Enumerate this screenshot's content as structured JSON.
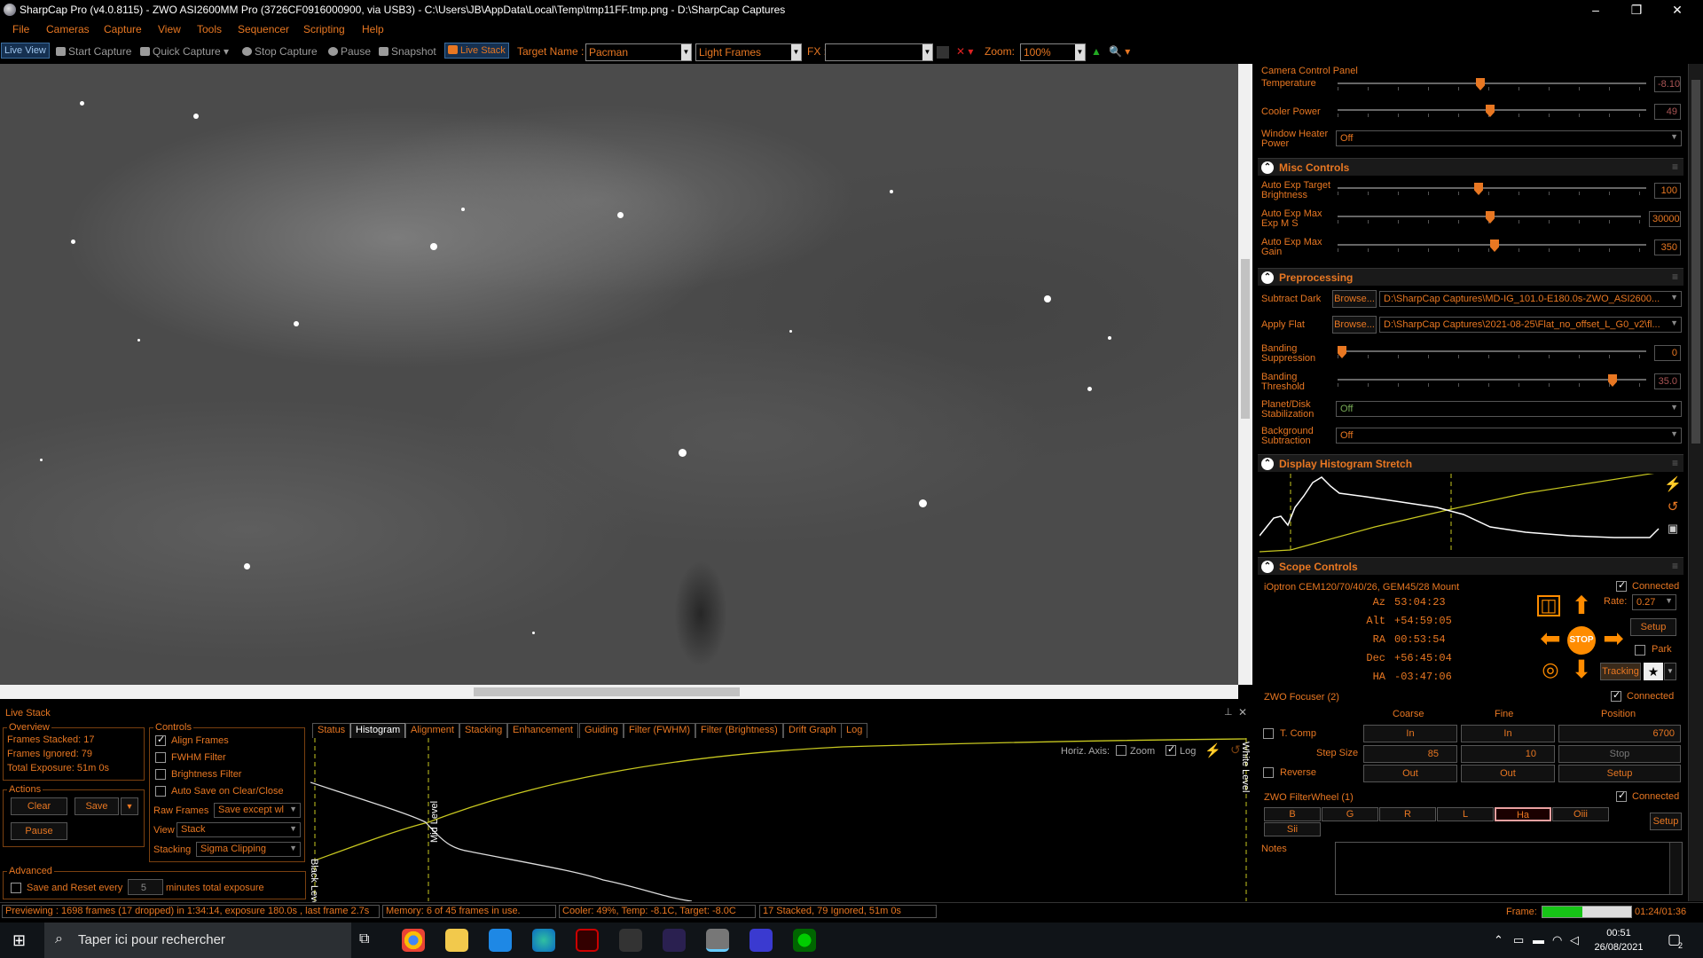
{
  "app": {
    "title": "SharpCap Pro (v4.0.8115) - ZWO ASI2600MM Pro (3726CF0916000900, via USB3) - C:\\Users\\JB\\AppData\\Local\\Temp\\tmp11FF.tmp.png - D:\\SharpCap Captures",
    "window_controls": [
      "–",
      "❐",
      "✕"
    ]
  },
  "menu": [
    "File",
    "Cameras",
    "Capture",
    "View",
    "Tools",
    "Sequencer",
    "Scripting",
    "Help"
  ],
  "toolbar": {
    "live_view": "Live View",
    "start_capture": "Start Capture",
    "quick_capture": "Quick Capture",
    "stop_capture": "Stop Capture",
    "pause": "Pause",
    "snapshot": "Snapshot",
    "live_stack": "Live Stack",
    "target_name_label": "Target Name :",
    "target_name": "Pacman",
    "frame_type": "Light Frames",
    "fx_label": "FX :",
    "fx_value": "",
    "zoom_label": "Zoom:",
    "zoom_value": "100%"
  },
  "camera_panel": {
    "title": "Camera Control Panel",
    "temperature_label": "Temperature",
    "temperature_value": "-8.10",
    "cooler_power_label": "Cooler Power",
    "cooler_power_value": "49",
    "window_heater_label": "Window Heater Power",
    "window_heater_value": "Off"
  },
  "misc": {
    "title": "Misc Controls",
    "auto_exp_target_label": "Auto Exp Target Brightness",
    "auto_exp_target_value": "100",
    "auto_exp_max_label": "Auto Exp Max Exp M S",
    "auto_exp_max_value": "30000",
    "auto_exp_gain_label": "Auto Exp Max Gain",
    "auto_exp_gain_value": "350"
  },
  "preprocessing": {
    "title": "Preprocessing",
    "subtract_dark_label": "Subtract Dark",
    "subtract_dark_path": "D:\\SharpCap Captures\\MD-IG_101.0-E180.0s-ZWO_ASI2600...",
    "apply_flat_label": "Apply Flat",
    "apply_flat_path": "D:\\SharpCap Captures\\2021-08-25\\Flat_no_offset_L_G0_v2\\fl...",
    "browse": "Browse...",
    "banding_supp_label": "Banding Suppression",
    "banding_supp_value": "0",
    "banding_thresh_label": "Banding Threshold",
    "banding_thresh_value": "35.0",
    "planet_label": "Planet/Disk Stabilization",
    "planet_value": "Off",
    "bg_sub_label": "Background Subtraction",
    "bg_sub_value": "Off"
  },
  "histogram_stretch": {
    "title": "Display Histogram Stretch"
  },
  "scope": {
    "title": "Scope Controls",
    "mount": "iOptron CEM120/70/40/26, GEM45/28 Mount",
    "connected": "Connected",
    "coords": [
      {
        "label": "Az",
        "value": "53:04:23"
      },
      {
        "label": "Alt",
        "value": "+54:59:05"
      },
      {
        "label": "RA",
        "value": "00:53:54"
      },
      {
        "label": "Dec",
        "value": "+56:45:04"
      },
      {
        "label": "HA",
        "value": "-03:47:06"
      }
    ],
    "rate_label": "Rate:",
    "rate_value": "0.27",
    "setup": "Setup",
    "park": "Park",
    "stop": "STOP",
    "tracking": "Tracking"
  },
  "focuser": {
    "title": "ZWO Focuser (2)",
    "connected": "Connected",
    "col_coarse": "Coarse",
    "col_fine": "Fine",
    "col_position": "Position",
    "tcomp": "T. Comp",
    "in": "In",
    "out": "Out",
    "position": "6700",
    "step_size_label": "Step Size",
    "coarse_step": "85",
    "fine_step": "10",
    "stop": "Stop",
    "reverse": "Reverse",
    "setup": "Setup"
  },
  "filterwheel": {
    "title": "ZWO FilterWheel (1)",
    "connected": "Connected",
    "filters": [
      "B",
      "G",
      "R",
      "L",
      "Ha",
      "Oiii",
      "Sii"
    ],
    "active": "Ha",
    "setup": "Setup"
  },
  "notes": {
    "label": "Notes"
  },
  "livestack": {
    "title": "Live Stack",
    "overview_title": "Overview",
    "frames_stacked": "Frames Stacked: 17",
    "frames_ignored": "Frames Ignored: 79",
    "total_exposure": "Total Exposure: 51m 0s",
    "actions_title": "Actions",
    "clear": "Clear",
    "save": "Save",
    "pause": "Pause",
    "advanced_title": "Advanced",
    "save_reset": "Save and Reset every",
    "minutes_value": "5",
    "minutes_label": "minutes total exposure",
    "controls_title": "Controls",
    "align_frames": "Align Frames",
    "fwhm_filter": "FWHM Filter",
    "brightness_filter": "Brightness Filter",
    "auto_save": "Auto Save on Clear/Close",
    "raw_frames_label": "Raw Frames",
    "raw_frames_value": "Save except wl",
    "view_label": "View",
    "view_value": "Stack",
    "stacking_label": "Stacking",
    "stacking_value": "Sigma Clipping",
    "tabs": [
      "Status",
      "Histogram",
      "Alignment",
      "Stacking",
      "Enhancement",
      "Guiding",
      "Filter (FWHM)",
      "Filter (Brightness)",
      "Drift Graph",
      "Log"
    ],
    "active_tab": "Histogram",
    "horiz_axis": "Horiz. Axis:",
    "zoom": "Zoom",
    "log": "Log",
    "black_level": "Black Level",
    "mid_level": "Mid Level",
    "white_level": "White Level"
  },
  "status": {
    "previewing": "Previewing : 1698 frames (17 dropped) in 1:34:14, exposure 180.0s , last frame 2.7s",
    "memory": "Memory: 6 of 45 frames in use.",
    "cooler": "Cooler: 49%, Temp: -8.1C, Target: -8.0C",
    "stacked": "17 Stacked, 79 Ignored, 51m 0s",
    "frame_label": "Frame:",
    "frame_time": "01:24/01:36",
    "frame_progress": 0.45
  },
  "taskbar": {
    "search": "Taper ici pour rechercher",
    "time": "00:51",
    "date": "26/08/2021",
    "notif_count": "2"
  },
  "colors": {
    "accent": "#e87722",
    "bg": "#000000"
  }
}
